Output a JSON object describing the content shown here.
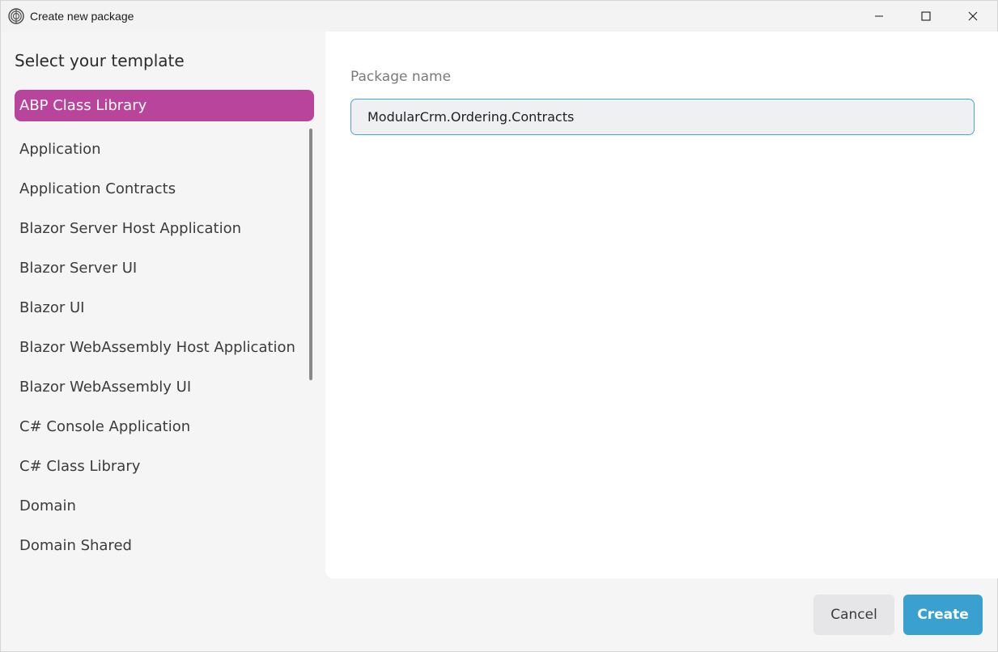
{
  "window": {
    "title": "Create new package",
    "icon": "abp-logo-icon",
    "controls": [
      "minimize-icon",
      "maximize-icon",
      "close-icon"
    ]
  },
  "left_panel": {
    "heading": "Select your template",
    "templates": [
      "ABP Class Library",
      "Application",
      "Application Contracts",
      "Blazor Server Host Application",
      "Blazor Server UI",
      "Blazor UI",
      "Blazor WebAssembly Host Application",
      "Blazor WebAssembly UI",
      "C# Console Application",
      "C# Class Library",
      "Domain",
      "Domain Shared"
    ],
    "selected_index": 0
  },
  "form": {
    "package_name_label": "Package name",
    "package_name_value": "ModularCrm.Ordering.Contracts"
  },
  "footer": {
    "cancel_label": "Cancel",
    "create_label": "Create"
  },
  "colors": {
    "selected_bg": "#b9449b",
    "accent": "#3aa0d0",
    "input_border": "#4aa3d4"
  }
}
